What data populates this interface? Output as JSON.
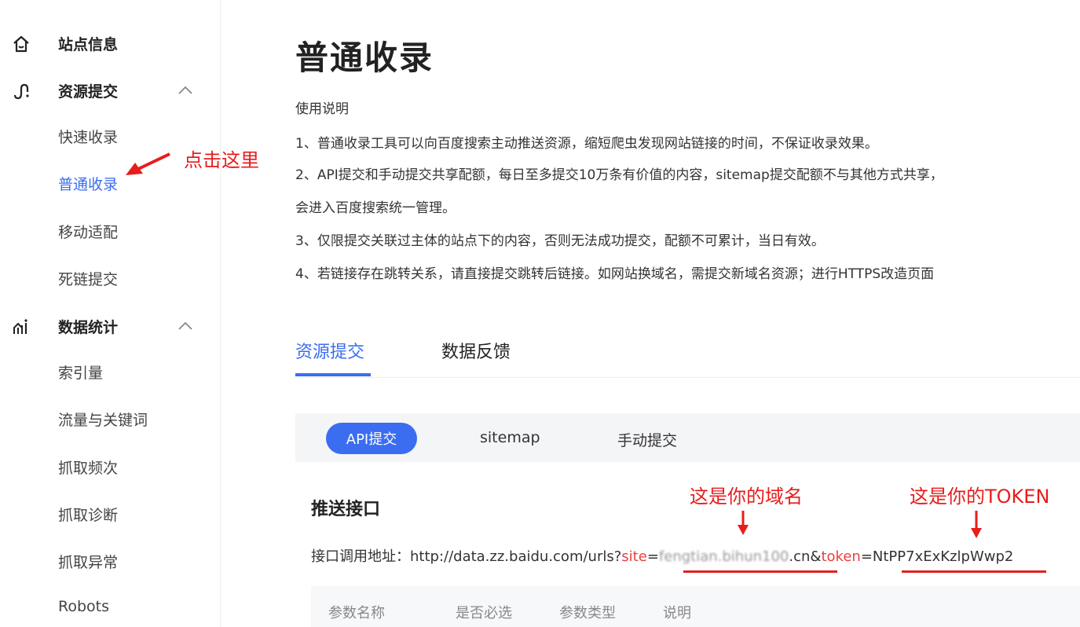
{
  "sidebar": {
    "groups": [
      {
        "label": "站点信息",
        "icon": "home-icon"
      },
      {
        "label": "资源提交",
        "icon": "resource-submit-icon"
      },
      {
        "label": "数据统计",
        "icon": "chart-stats-icon"
      }
    ],
    "items": [
      {
        "label": "快速收录"
      },
      {
        "label": "普通收录"
      },
      {
        "label": "移动适配"
      },
      {
        "label": "死链提交"
      },
      {
        "label": "索引量"
      },
      {
        "label": "流量与关键词"
      },
      {
        "label": "抓取频次"
      },
      {
        "label": "抓取诊断"
      },
      {
        "label": "抓取异常"
      },
      {
        "label": "Robots"
      }
    ]
  },
  "main": {
    "title": "普通收录",
    "instructions": [
      "使用说明",
      "1、普通收录工具可以向百度搜索主动推送资源，缩短爬虫发现网站链接的时间，不保证收录效果。",
      "2、API提交和手动提交共享配额，每日至多提交10万条有价值的内容，sitemap提交配额不与其他方式共享，",
      "会进入百度搜索统一管理。",
      "3、仅限提交关联过主体的站点下的内容，否则无法成功提交，配额不可累计，当日有效。",
      "4、若链接存在跳转关系，请直接提交跳转后链接。如网站换域名，需提交新域名资源；进行HTTPS改造页面"
    ],
    "tabs": [
      {
        "label": "资源提交"
      },
      {
        "label": "数据反馈"
      }
    ],
    "subtabs": [
      {
        "label": "API提交"
      },
      {
        "label": "sitemap"
      },
      {
        "label": "手动提交"
      }
    ],
    "section_title": "推送接口",
    "endpoint": {
      "label": "接口调用地址：",
      "base": "http://data.zz.baidu.com/urls?",
      "site_key": "site",
      "eq1": "=",
      "site_value": "fengtian.bihun100",
      "site_suffix": ".cn",
      "amp": "&",
      "token_key": "token",
      "eq2": "=",
      "token_value": "NtPP7xExKzlpWwp2"
    },
    "table_headers": [
      "参数名称",
      "是否必选",
      "参数类型",
      "说明"
    ]
  },
  "annotations": {
    "click_here": "点击这里",
    "your_domain": "这是你的域名",
    "your_token": "这是你的TOKEN"
  },
  "colors": {
    "accent": "#3a6df0",
    "annotation_red": "#e02020",
    "param_red": "#e84040"
  }
}
